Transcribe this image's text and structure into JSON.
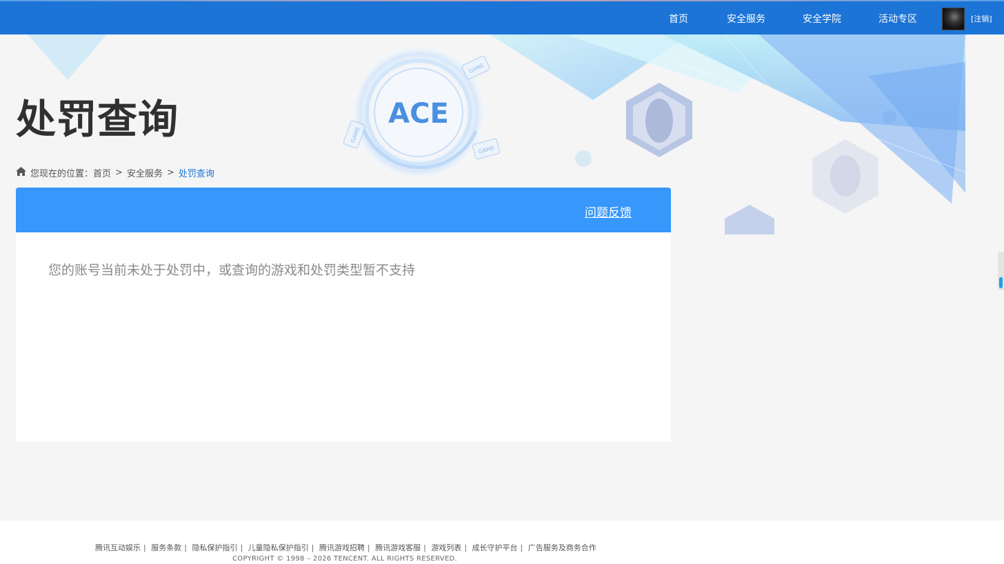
{
  "navbar": {
    "items": [
      {
        "label": "首页"
      },
      {
        "label": "安全服务"
      },
      {
        "label": "安全学院"
      },
      {
        "label": "活动专区"
      }
    ],
    "logout_label": "[注销]",
    "bg_color": "#1b74d6"
  },
  "page": {
    "title": "处罚查询"
  },
  "breadcrumb": {
    "prefix": "您现在的位置：",
    "items": [
      "首页",
      "安全服务",
      "处罚查询"
    ],
    "separator": ">"
  },
  "card": {
    "feedback_label": "问题反馈",
    "message": "您的账号当前未处于处罚中，或查询的游戏和处罚类型暂不支持",
    "header_color": "#3797fb"
  },
  "banner": {
    "logo_text": "ACE",
    "badge_text": "GAME"
  },
  "footer": {
    "links": [
      "腾讯互动娱乐",
      "服务条款",
      "隐私保护指引",
      "儿童隐私保护指引",
      "腾讯游戏招聘",
      "腾讯游戏客服",
      "游戏列表",
      "成长守护平台",
      "广告服务及商务合作"
    ],
    "separator": "|",
    "copyright": "COPYRIGHT © 1998 – 2026 TENCENT. ALL RIGHTS RESERVED."
  },
  "icons": {
    "home": "home-icon",
    "avatar": "user-avatar"
  }
}
